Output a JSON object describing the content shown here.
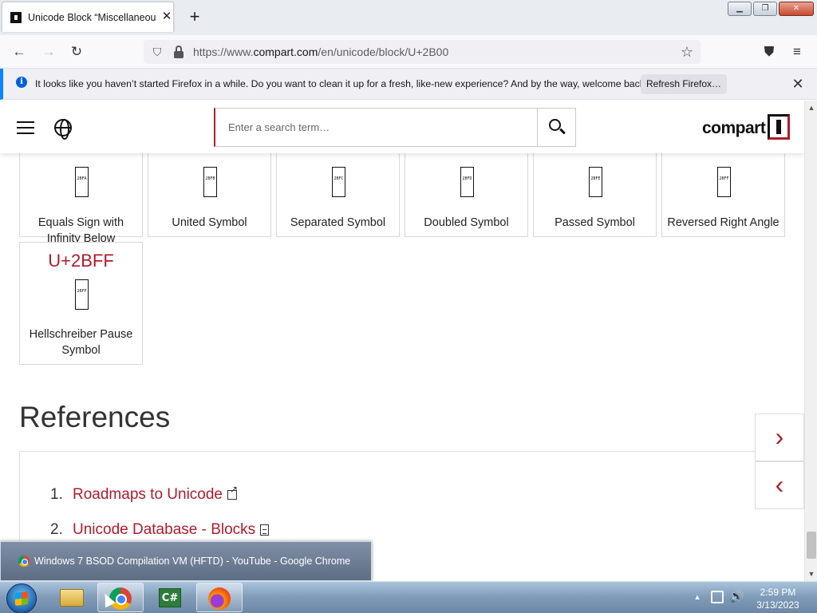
{
  "browser": {
    "tab_title": "Unicode Block “Miscellaneous S",
    "url_prefix": "https://www.",
    "url_host": "compart.com",
    "url_path": "/en/unicode/block/U+2B00",
    "window_controls": [
      "minimize-icon",
      "restore-icon",
      "close-icon"
    ],
    "notification": {
      "text": "It looks like you haven’t started Firefox in a while. Do you want to clean it up for a fresh, like-new experience? And by the way, welcome back!",
      "button_label": "Refresh Firefox…"
    }
  },
  "site": {
    "search_placeholder": "Enter a search term…",
    "logo_text": "compart"
  },
  "cards": [
    {
      "name": "Equals Sign with Infinity Below",
      "glyph": "2BFA"
    },
    {
      "name": "United Symbol",
      "glyph": "2BFB"
    },
    {
      "name": "Separated Symbol",
      "glyph": "2BFC"
    },
    {
      "name": "Doubled Symbol",
      "glyph": "2BFD"
    },
    {
      "name": "Passed Symbol",
      "glyph": "2BFE"
    },
    {
      "name": "Reversed Right Angle",
      "glyph": "2BFF"
    }
  ],
  "last_card": {
    "code": "U+2BFF",
    "glyph": "2BFF",
    "name": "Hellschreiber Pause Symbol"
  },
  "references": {
    "heading": "References",
    "items": [
      {
        "num": "1.",
        "label": "Roadmaps to Unicode"
      },
      {
        "num": "2.",
        "label": "Unicode Database - Blocks"
      }
    ]
  },
  "side_nav": {
    "next": "›",
    "prev": "‹"
  },
  "taskbar": {
    "preview_title": "Windows 7 BSOD Compilation VM (HFTD) - YouTube - Google Chrome",
    "cs_label": "C#",
    "time": "2:59 PM",
    "date": "3/13/2023"
  },
  "colors": {
    "accent": "#b01c2b",
    "firefox_info": "#0060df"
  }
}
